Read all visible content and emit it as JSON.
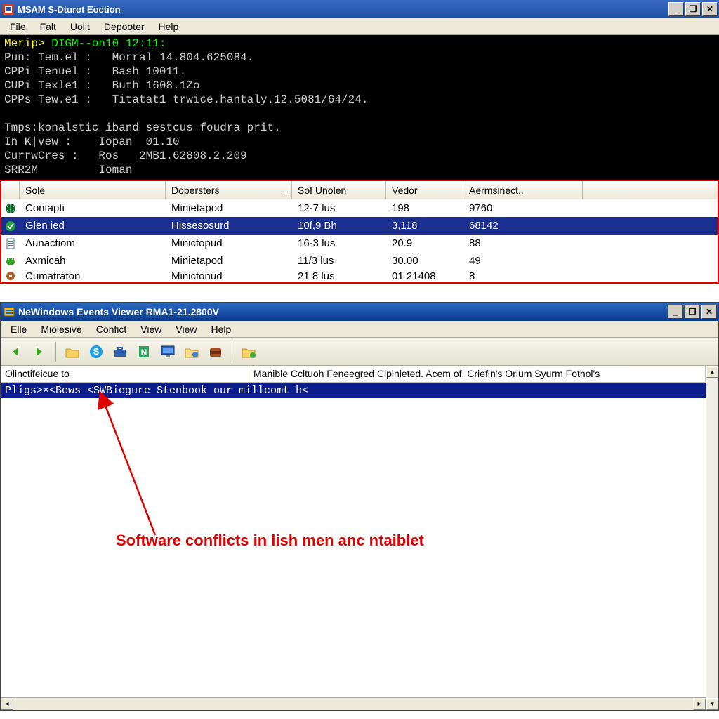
{
  "win1": {
    "title": "MSAM S-Dturot Eoction",
    "menu": [
      "File",
      "Falt",
      "Uolit",
      "Depooter",
      "Help"
    ],
    "win_buttons": {
      "min": "_",
      "max": "❐",
      "close": "✕"
    },
    "console": {
      "line1_prompt": "Merip>",
      "line1_cmd": " DIGM--on10 12:11:",
      "lines": [
        "Pun: Tem.el :   Morral 14.804.625084.",
        "CPPi Tenuel :   Bash 10011.",
        "CUPi Texle1 :   Buth 1608.1Zo",
        "CPPs Tew.e1 :   Titatat1 trwice.hantaly.12.5081/64/24.",
        "",
        "Tmps:konalstic iband sestcus foudra prit.",
        "In K|vew :    Iopan  01.10",
        "CurrwCres :   Ros   2MB1.62808.2.209",
        "SRR2M         Ioman"
      ]
    },
    "table": {
      "headers": [
        "",
        "Sole",
        "Dopersters",
        "Sof Unolen",
        "Vedor",
        "Aermsinect.."
      ],
      "rows": [
        {
          "icon": "globe-icon",
          "cells": [
            "Contapti",
            "Minietapod",
            "12-7 lus",
            "198",
            "9760"
          ],
          "selected": false
        },
        {
          "icon": "check-icon",
          "cells": [
            "Glen ied",
            "Hissesosurd",
            "10f,9 Bh",
            "3,118",
            "68142"
          ],
          "selected": true
        },
        {
          "icon": "doc-icon",
          "cells": [
            "Aunactiom",
            "Minictopud",
            "16-3 lus",
            "20.9",
            "88"
          ],
          "selected": false
        },
        {
          "icon": "frog-icon",
          "cells": [
            "Axmicah",
            "Minietapod",
            "11/3 lus",
            "30.00",
            "49"
          ],
          "selected": false
        },
        {
          "icon": "gear-icon",
          "cells": [
            "Cumatraton",
            "Minictonud",
            "21 8 lus",
            "01 21408",
            "8"
          ],
          "selected": false
        }
      ]
    }
  },
  "win2": {
    "title": "NeWindows Events Viewer RMA1-21.2800V",
    "menu": [
      "Elle",
      "Miolesive",
      "Confict",
      "View",
      "View",
      "Help"
    ],
    "win_buttons": {
      "min": "_",
      "max": "❐",
      "close": "✕"
    },
    "toolbar_icons": [
      "back-icon",
      "forward-icon",
      "sep",
      "folder-icon",
      "skype-icon",
      "briefcase-icon",
      "note-icon",
      "computer-icon",
      "folder2-icon",
      "wallet-icon",
      "sep",
      "folder3-icon"
    ],
    "columns": {
      "c1": "Olinctifeicue to",
      "c2": "Manible Ccltuoh Feneegred Clpinleted. Acem of. Criefin's Orium Syurm Fothol's"
    },
    "row": "Pligs>×<Bews <SWBiegure Stenbook our millcomt h<",
    "annotation": "Software conflicts in lish men anc ntaiblet"
  }
}
